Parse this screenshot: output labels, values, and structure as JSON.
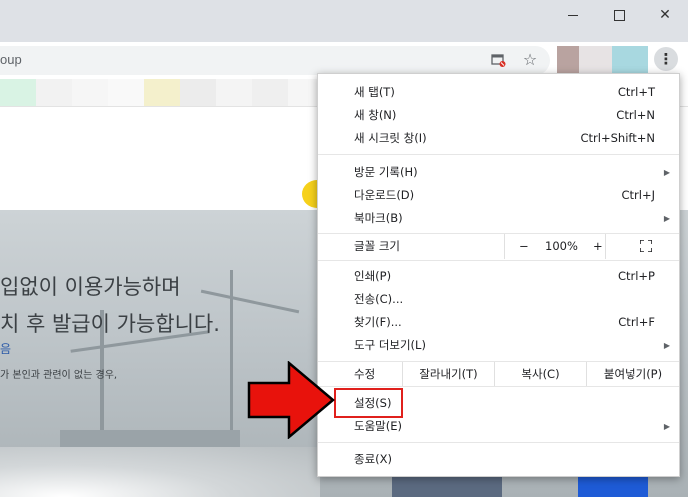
{
  "window": {
    "minimize_icon": "minimize-icon",
    "maximize_icon": "maximize-icon",
    "close_icon": "close-icon"
  },
  "omnibox": {
    "url": "oup",
    "cast_icon": "cast-blocked-icon",
    "star_icon": "bookmark-star-icon"
  },
  "extensions": [
    "#b9a3a0",
    "#e7e3e4",
    "#a8d8e0"
  ],
  "menu_button_icon": "more-vert-icon",
  "hero": {
    "line1": "입없이 이용가능하며",
    "line2": "치 후 발급이 가능합니다.",
    "link": "음",
    "note": "가 본인과 관련이 없는 경우,"
  },
  "menu": {
    "new_tab": {
      "label": "새 탭(T)",
      "shortcut": "Ctrl+T"
    },
    "new_window": {
      "label": "새 창(N)",
      "shortcut": "Ctrl+N"
    },
    "incognito": {
      "label": "새 시크릿 창(I)",
      "shortcut": "Ctrl+Shift+N"
    },
    "history": {
      "label": "방문 기록(H)"
    },
    "downloads": {
      "label": "다운로드(D)",
      "shortcut": "Ctrl+J"
    },
    "bookmarks": {
      "label": "북마크(B)"
    },
    "zoom": {
      "label": "글꼴 크기",
      "minus": "−",
      "value": "100%",
      "plus": "+"
    },
    "print": {
      "label": "인쇄(P)",
      "shortcut": "Ctrl+P"
    },
    "cast": {
      "label": "전송(C)..."
    },
    "find": {
      "label": "찾기(F)...",
      "shortcut": "Ctrl+F"
    },
    "more_tools": {
      "label": "도구 더보기(L)"
    },
    "edit": {
      "label": "수정",
      "cut": "잘라내기(T)",
      "copy": "복사(C)",
      "paste": "붙여넣기(P)"
    },
    "settings": {
      "label": "설정(S)"
    },
    "help": {
      "label": "도움말(E)"
    },
    "exit": {
      "label": "종료(X)"
    }
  },
  "colors": {
    "accent_arrow": "#e8120c",
    "highlight_box": "#e0201c",
    "titlebar": "#dee1e6"
  }
}
